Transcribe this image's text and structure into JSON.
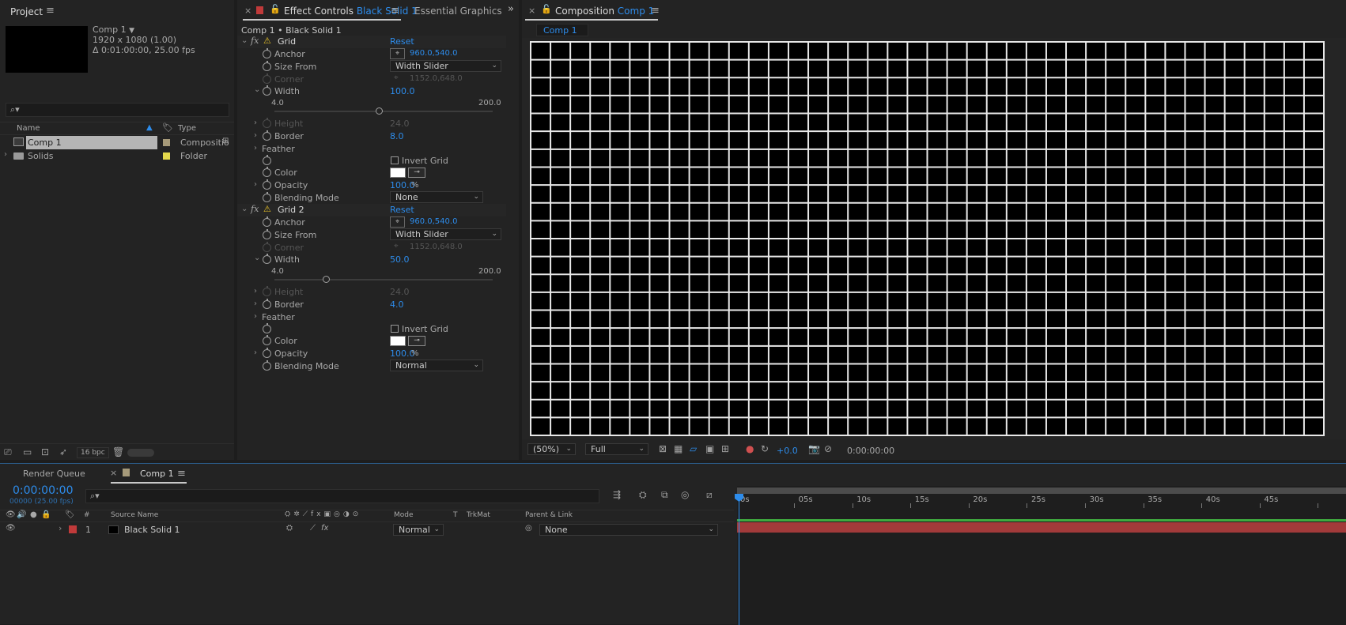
{
  "project": {
    "tab_label": "Project",
    "comp_name": "Comp 1",
    "comp_res": "1920 x 1080 (1.00)",
    "comp_duration": "Δ 0:01:00:00, 25.00 fps",
    "col_name": "Name",
    "col_type": "Type",
    "items": [
      {
        "name": "Comp 1",
        "type": "Compositio",
        "label_color": "#a69a7a"
      },
      {
        "name": "Solids",
        "type": "Folder",
        "label_color": "#e4d84c"
      }
    ],
    "bpc": "16 bpc"
  },
  "effects": {
    "tab_label": "Effect Controls",
    "tab_layer": "Black Solid 1",
    "tab2_label": "Essential Graphics",
    "breadcrumb": "Comp 1 • Black Solid 1",
    "grid1": {
      "name": "Grid",
      "reset": "Reset",
      "anchor_label": "Anchor",
      "anchor_value": "960.0,540.0",
      "sizefrom_label": "Size From",
      "sizefrom_value": "Width Slider",
      "corner_label": "Corner",
      "corner_value": "1152.0,648.0",
      "width_label": "Width",
      "width_value": "100.0",
      "width_min": "4.0",
      "width_max": "200.0",
      "width_fraction": 0.48,
      "height_label": "Height",
      "height_value": "24.0",
      "border_label": "Border",
      "border_value": "8.0",
      "feather_label": "Feather",
      "invert_label": "Invert Grid",
      "color_label": "Color",
      "opacity_label": "Opacity",
      "opacity_value": "100.0",
      "opacity_unit": "%",
      "blend_label": "Blending Mode",
      "blend_value": "None"
    },
    "grid2": {
      "name": "Grid 2",
      "reset": "Reset",
      "anchor_label": "Anchor",
      "anchor_value": "960.0,540.0",
      "sizefrom_label": "Size From",
      "sizefrom_value": "Width Slider",
      "corner_label": "Corner",
      "corner_value": "1152.0,648.0",
      "width_label": "Width",
      "width_value": "50.0",
      "width_min": "4.0",
      "width_max": "200.0",
      "width_fraction": 0.235,
      "height_label": "Height",
      "height_value": "24.0",
      "border_label": "Border",
      "border_value": "4.0",
      "feather_label": "Feather",
      "invert_label": "Invert Grid",
      "color_label": "Color",
      "opacity_label": "Opacity",
      "opacity_value": "100.0",
      "opacity_unit": "%",
      "blend_label": "Blending Mode",
      "blend_value": "Normal"
    }
  },
  "composition": {
    "tab_label": "Composition",
    "tab_comp": "Comp 1",
    "subtab": "Comp 1",
    "zoom": "(50%)",
    "resolution": "Full",
    "exposure": "+0.0",
    "timecode": "0:00:00:00"
  },
  "timeline": {
    "render_queue": "Render Queue",
    "tab_comp": "Comp 1",
    "timecode": "0:00:00:00",
    "frames": "00000 (25.00 fps)",
    "col_num": "#",
    "col_source": "Source Name",
    "col_mode": "Mode",
    "col_t": "T",
    "col_trkmat": "TrkMat",
    "col_parent": "Parent & Link",
    "layer": {
      "num": "1",
      "name": "Black Solid 1",
      "mode": "Normal",
      "parent": "None",
      "label_color": "#c03a3a"
    },
    "ruler": [
      "0s",
      "05s",
      "10s",
      "15s",
      "20s",
      "25s",
      "30s",
      "35s",
      "40s",
      "45s"
    ]
  }
}
